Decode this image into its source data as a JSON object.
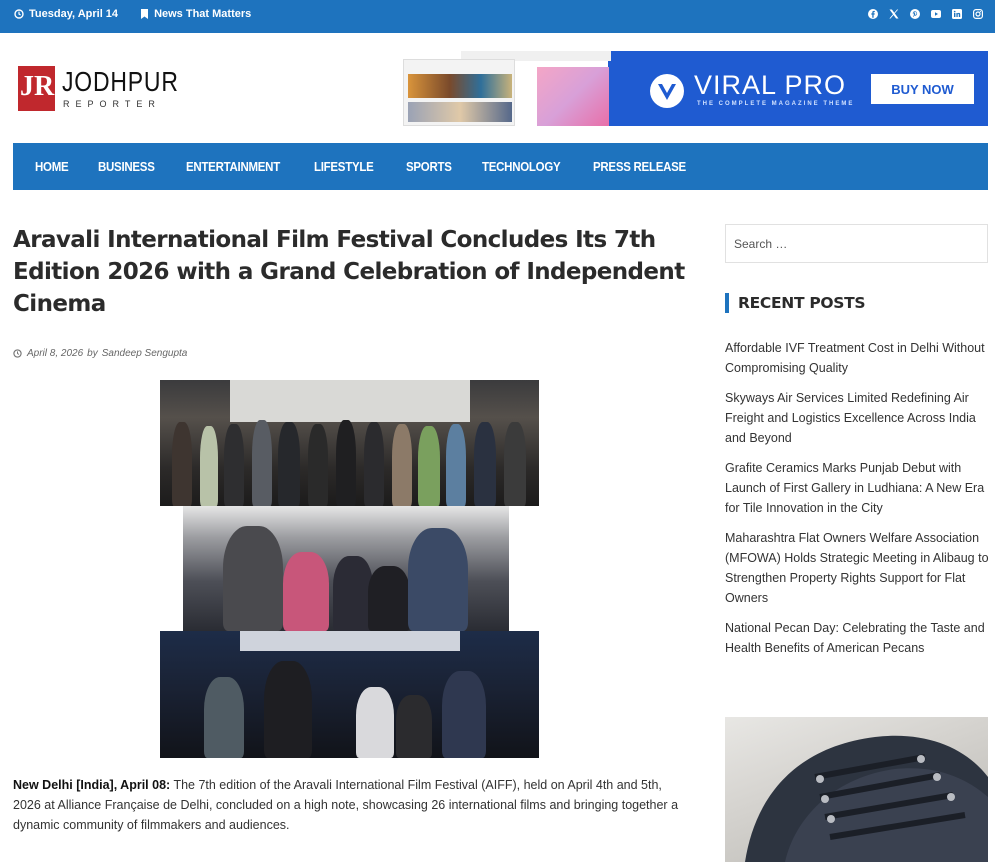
{
  "topbar": {
    "date": "Tuesday, April 14",
    "tagline": "News That Matters",
    "social": [
      "facebook-icon",
      "x-icon",
      "pinterest-icon",
      "youtube-icon",
      "linkedin-icon",
      "instagram-icon"
    ]
  },
  "logo": {
    "mark": "JR",
    "name": "JODHPUR",
    "sub": "REPORTER"
  },
  "ad": {
    "title": "VIRAL PRO",
    "subtitle": "THE COMPLETE MAGAZINE THEME",
    "button": "BUY NOW"
  },
  "nav": {
    "items": [
      "HOME",
      "BUSINESS",
      "ENTERTAINMENT",
      "LIFESTYLE",
      "SPORTS",
      "TECHNOLOGY",
      "PRESS RELEASE"
    ]
  },
  "article": {
    "title": "Aravali International Film Festival Concludes Its 7th Edition 2026 with a Grand Celebration of Independent Cinema",
    "date": "April 8, 2026",
    "by": "by",
    "author": "Sandeep Sengupta",
    "lead_dateline": "New Delhi [India], April 08:",
    "lead_text": " The 7th edition of the Aravali International Film Festival (AIFF), held on April 4th and 5th, 2026 at Alliance Française de Delhi, concluded on a high note, showcasing 26 international films and bringing together a dynamic community of filmmakers and audiences."
  },
  "sidebar": {
    "search_placeholder": "Search …",
    "recent_heading": "RECENT POSTS",
    "recent_posts": [
      "Affordable IVF Treatment Cost in Delhi Without Compromising Quality",
      "Skyways Air Services Limited Redefining Air Freight and Logistics Excellence Across India and Beyond",
      "Grafite Ceramics Marks Punjab Debut with Launch of First Gallery in Ludhiana: A New Era for Tile Innovation in the City",
      "Maharashtra Flat Owners Welfare Association (MFOWA) Holds Strategic Meeting in Alibaug to Strengthen Property Rights Support for Flat Owners",
      "National Pecan Day: Celebrating the Taste and Health Benefits of American Pecans"
    ]
  },
  "colors": {
    "brand_blue": "#1e73be",
    "logo_red": "#c0282d"
  }
}
